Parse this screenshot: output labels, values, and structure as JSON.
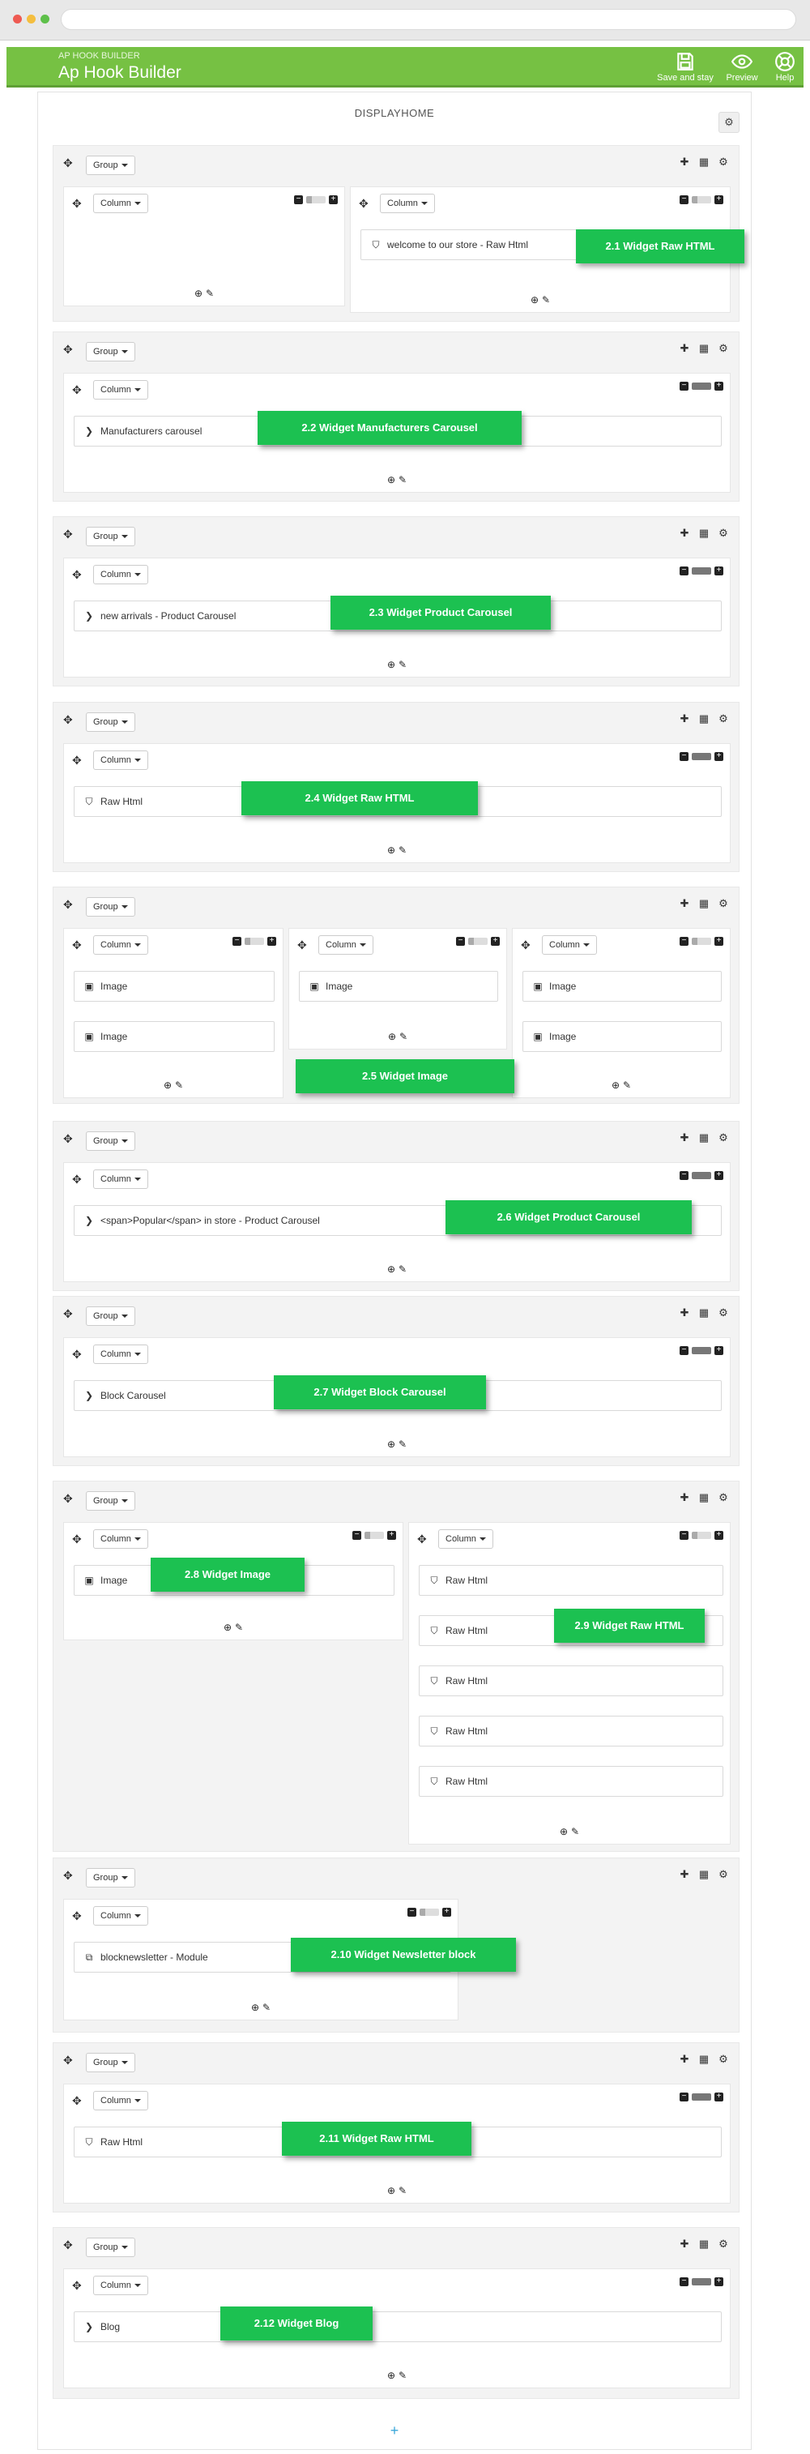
{
  "app": {
    "breadcrumb": "AP HOOK BUILDER",
    "title": "Ap Hook Builder",
    "accent_color": "#76c143",
    "toolbar": {
      "save_label": "Save and stay",
      "preview_label": "Preview",
      "help_label": "Help"
    }
  },
  "hook": {
    "title": "DISPLAYHOME"
  },
  "labels": {
    "group": "Group",
    "column": "Column"
  },
  "widgets": {
    "w1": "welcome to our store - Raw Html",
    "w2": "Manufacturers carousel",
    "w3": "new arrivals - Product Carousel",
    "w4": "Raw Html",
    "w5": "Image",
    "w6": "<span>Popular</span> in store - Product Carousel",
    "w7": "Block Carousel",
    "w8": "Image",
    "w9": "Raw Html",
    "w10": "blocknewsletter - Module",
    "w11": "Raw Html",
    "w12": "Blog"
  },
  "callouts": {
    "c1": "2.1 Widget Raw HTML",
    "c2": "2.2 Widget Manufacturers Carousel",
    "c3": "2.3 Widget Product Carousel",
    "c4": "2.4 Widget Raw HTML",
    "c5": "2.5 Widget Image",
    "c6": "2.6 Widget Product Carousel",
    "c7": "2.7 Widget Block Carousel",
    "c8": "2.8 Widget Image",
    "c9": "2.9 Widget Raw HTML",
    "c10": "2.10 Widget Newsletter block",
    "c11": "2.11 Widget Raw HTML",
    "c12": "2.12 Widget Blog"
  },
  "icons": {
    "move": "move-icon",
    "add": "plus-icon",
    "grid": "grid-icon",
    "settings": "gear-icon",
    "minus": "minus-icon",
    "width": "width-bar-icon",
    "edit": "pencil-icon",
    "add_circle": "plus-circle-icon",
    "html": "html5-icon",
    "image": "image-icon",
    "carousel": "chevron-right-icon",
    "module": "module-icon"
  }
}
